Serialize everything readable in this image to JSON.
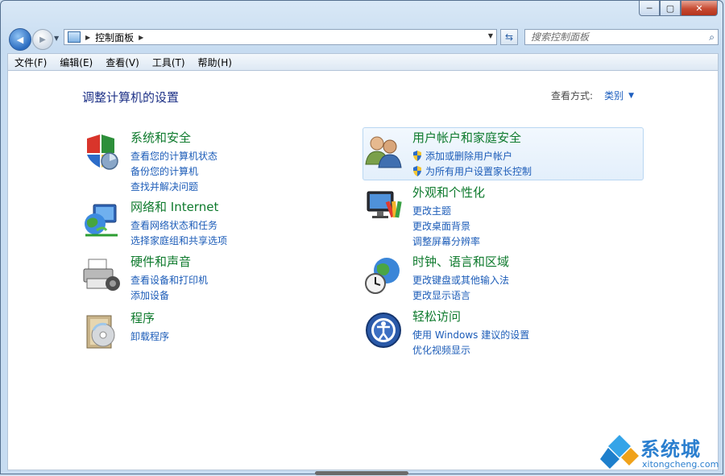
{
  "window": {
    "caption": {
      "minimize": "─",
      "maximize": "▢",
      "close": "✕"
    }
  },
  "nav": {
    "back_glyph": "◀",
    "forward_glyph": "▶",
    "address_path": "控制面板",
    "search_placeholder": "搜索控制面板"
  },
  "menu": [
    "文件(F)",
    "编辑(E)",
    "查看(V)",
    "工具(T)",
    "帮助(H)"
  ],
  "page": {
    "title": "调整计算机的设置",
    "view_by_label": "查看方式:",
    "view_by_value": "类别"
  },
  "categories": [
    {
      "icon": "security-shield-icon",
      "title": "系统和安全",
      "links": [
        "查看您的计算机状态",
        "备份您的计算机",
        "查找并解决问题"
      ]
    },
    {
      "icon": "network-globe-icon",
      "title": "网络和 Internet",
      "links": [
        "查看网络状态和任务",
        "选择家庭组和共享选项"
      ]
    },
    {
      "icon": "printer-hardware-icon",
      "title": "硬件和声音",
      "links": [
        "查看设备和打印机",
        "添加设备"
      ]
    },
    {
      "icon": "programs-disc-icon",
      "title": "程序",
      "links": [
        "卸载程序"
      ]
    },
    {
      "icon": "users-icon",
      "title": "用户帐户和家庭安全",
      "links": [
        "添加或删除用户帐户",
        "为所有用户设置家长控制"
      ],
      "shielded": true
    },
    {
      "icon": "appearance-monitor-icon",
      "title": "外观和个性化",
      "links": [
        "更改主题",
        "更改桌面背景",
        "调整屏幕分辨率"
      ]
    },
    {
      "icon": "clock-globe-icon",
      "title": "时钟、语言和区域",
      "links": [
        "更改键盘或其他输入法",
        "更改显示语言"
      ]
    },
    {
      "icon": "ease-of-access-icon",
      "title": "轻松访问",
      "links": [
        "使用 Windows 建议的设置",
        "优化视频显示"
      ]
    }
  ],
  "watermark": {
    "title": "系统城",
    "url": "xitongcheng.com"
  },
  "colors": {
    "title_green": "#0e7a2d",
    "link_blue": "#1c5cb8",
    "heading_blue": "#1e3287"
  }
}
